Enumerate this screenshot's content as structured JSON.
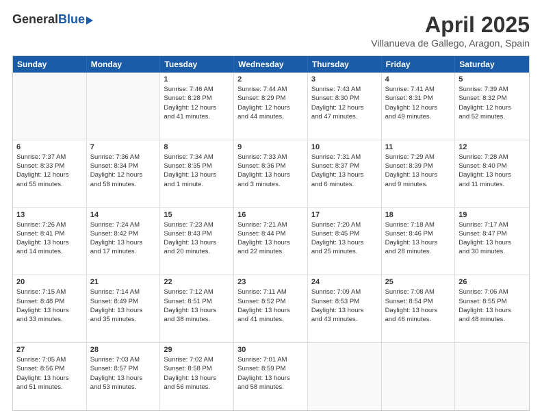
{
  "logo": {
    "general": "General",
    "blue": "Blue"
  },
  "title": "April 2025",
  "subtitle": "Villanueva de Gallego, Aragon, Spain",
  "header_days": [
    "Sunday",
    "Monday",
    "Tuesday",
    "Wednesday",
    "Thursday",
    "Friday",
    "Saturday"
  ],
  "weeks": [
    [
      {
        "day": "",
        "lines": []
      },
      {
        "day": "",
        "lines": []
      },
      {
        "day": "1",
        "lines": [
          "Sunrise: 7:46 AM",
          "Sunset: 8:28 PM",
          "Daylight: 12 hours",
          "and 41 minutes."
        ]
      },
      {
        "day": "2",
        "lines": [
          "Sunrise: 7:44 AM",
          "Sunset: 8:29 PM",
          "Daylight: 12 hours",
          "and 44 minutes."
        ]
      },
      {
        "day": "3",
        "lines": [
          "Sunrise: 7:43 AM",
          "Sunset: 8:30 PM",
          "Daylight: 12 hours",
          "and 47 minutes."
        ]
      },
      {
        "day": "4",
        "lines": [
          "Sunrise: 7:41 AM",
          "Sunset: 8:31 PM",
          "Daylight: 12 hours",
          "and 49 minutes."
        ]
      },
      {
        "day": "5",
        "lines": [
          "Sunrise: 7:39 AM",
          "Sunset: 8:32 PM",
          "Daylight: 12 hours",
          "and 52 minutes."
        ]
      }
    ],
    [
      {
        "day": "6",
        "lines": [
          "Sunrise: 7:37 AM",
          "Sunset: 8:33 PM",
          "Daylight: 12 hours",
          "and 55 minutes."
        ]
      },
      {
        "day": "7",
        "lines": [
          "Sunrise: 7:36 AM",
          "Sunset: 8:34 PM",
          "Daylight: 12 hours",
          "and 58 minutes."
        ]
      },
      {
        "day": "8",
        "lines": [
          "Sunrise: 7:34 AM",
          "Sunset: 8:35 PM",
          "Daylight: 13 hours",
          "and 1 minute."
        ]
      },
      {
        "day": "9",
        "lines": [
          "Sunrise: 7:33 AM",
          "Sunset: 8:36 PM",
          "Daylight: 13 hours",
          "and 3 minutes."
        ]
      },
      {
        "day": "10",
        "lines": [
          "Sunrise: 7:31 AM",
          "Sunset: 8:37 PM",
          "Daylight: 13 hours",
          "and 6 minutes."
        ]
      },
      {
        "day": "11",
        "lines": [
          "Sunrise: 7:29 AM",
          "Sunset: 8:39 PM",
          "Daylight: 13 hours",
          "and 9 minutes."
        ]
      },
      {
        "day": "12",
        "lines": [
          "Sunrise: 7:28 AM",
          "Sunset: 8:40 PM",
          "Daylight: 13 hours",
          "and 11 minutes."
        ]
      }
    ],
    [
      {
        "day": "13",
        "lines": [
          "Sunrise: 7:26 AM",
          "Sunset: 8:41 PM",
          "Daylight: 13 hours",
          "and 14 minutes."
        ]
      },
      {
        "day": "14",
        "lines": [
          "Sunrise: 7:24 AM",
          "Sunset: 8:42 PM",
          "Daylight: 13 hours",
          "and 17 minutes."
        ]
      },
      {
        "day": "15",
        "lines": [
          "Sunrise: 7:23 AM",
          "Sunset: 8:43 PM",
          "Daylight: 13 hours",
          "and 20 minutes."
        ]
      },
      {
        "day": "16",
        "lines": [
          "Sunrise: 7:21 AM",
          "Sunset: 8:44 PM",
          "Daylight: 13 hours",
          "and 22 minutes."
        ]
      },
      {
        "day": "17",
        "lines": [
          "Sunrise: 7:20 AM",
          "Sunset: 8:45 PM",
          "Daylight: 13 hours",
          "and 25 minutes."
        ]
      },
      {
        "day": "18",
        "lines": [
          "Sunrise: 7:18 AM",
          "Sunset: 8:46 PM",
          "Daylight: 13 hours",
          "and 28 minutes."
        ]
      },
      {
        "day": "19",
        "lines": [
          "Sunrise: 7:17 AM",
          "Sunset: 8:47 PM",
          "Daylight: 13 hours",
          "and 30 minutes."
        ]
      }
    ],
    [
      {
        "day": "20",
        "lines": [
          "Sunrise: 7:15 AM",
          "Sunset: 8:48 PM",
          "Daylight: 13 hours",
          "and 33 minutes."
        ]
      },
      {
        "day": "21",
        "lines": [
          "Sunrise: 7:14 AM",
          "Sunset: 8:49 PM",
          "Daylight: 13 hours",
          "and 35 minutes."
        ]
      },
      {
        "day": "22",
        "lines": [
          "Sunrise: 7:12 AM",
          "Sunset: 8:51 PM",
          "Daylight: 13 hours",
          "and 38 minutes."
        ]
      },
      {
        "day": "23",
        "lines": [
          "Sunrise: 7:11 AM",
          "Sunset: 8:52 PM",
          "Daylight: 13 hours",
          "and 41 minutes."
        ]
      },
      {
        "day": "24",
        "lines": [
          "Sunrise: 7:09 AM",
          "Sunset: 8:53 PM",
          "Daylight: 13 hours",
          "and 43 minutes."
        ]
      },
      {
        "day": "25",
        "lines": [
          "Sunrise: 7:08 AM",
          "Sunset: 8:54 PM",
          "Daylight: 13 hours",
          "and 46 minutes."
        ]
      },
      {
        "day": "26",
        "lines": [
          "Sunrise: 7:06 AM",
          "Sunset: 8:55 PM",
          "Daylight: 13 hours",
          "and 48 minutes."
        ]
      }
    ],
    [
      {
        "day": "27",
        "lines": [
          "Sunrise: 7:05 AM",
          "Sunset: 8:56 PM",
          "Daylight: 13 hours",
          "and 51 minutes."
        ]
      },
      {
        "day": "28",
        "lines": [
          "Sunrise: 7:03 AM",
          "Sunset: 8:57 PM",
          "Daylight: 13 hours",
          "and 53 minutes."
        ]
      },
      {
        "day": "29",
        "lines": [
          "Sunrise: 7:02 AM",
          "Sunset: 8:58 PM",
          "Daylight: 13 hours",
          "and 56 minutes."
        ]
      },
      {
        "day": "30",
        "lines": [
          "Sunrise: 7:01 AM",
          "Sunset: 8:59 PM",
          "Daylight: 13 hours",
          "and 58 minutes."
        ]
      },
      {
        "day": "",
        "lines": []
      },
      {
        "day": "",
        "lines": []
      },
      {
        "day": "",
        "lines": []
      }
    ]
  ]
}
